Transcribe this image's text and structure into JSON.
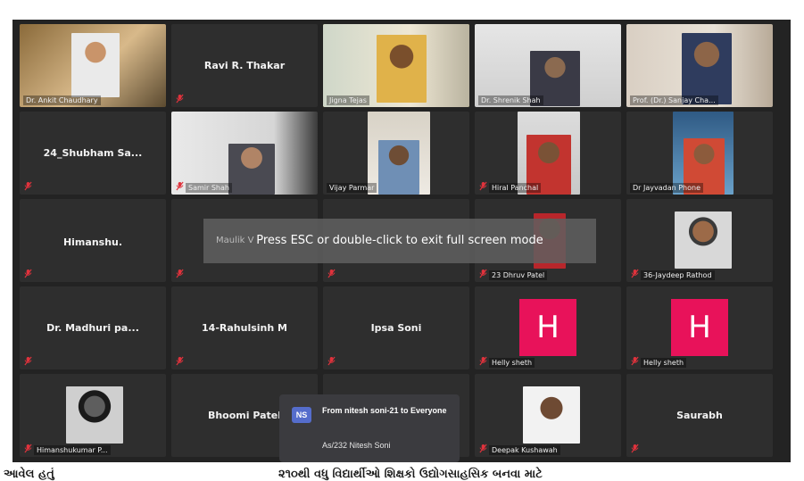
{
  "fullscreen_notice": "Press ESC or double-click to exit full screen mode",
  "faded_participant": "Maulik V",
  "participants": [
    {
      "name": "Dr. Ankit Chaudhary",
      "video": true
    },
    {
      "name": "Ravi R. Thakar",
      "video": false
    },
    {
      "name": "Jigna Tejas",
      "video": true,
      "active_speaker": true
    },
    {
      "name": "Dr. Shrenik Shah",
      "video": true
    },
    {
      "name": "Prof. (Dr.) Sanjay Cha...",
      "video": true
    },
    {
      "name": "24_Shubham Sa...",
      "video": false
    },
    {
      "name": "Samir Shah",
      "video": true
    },
    {
      "name": "Vijay Parmar",
      "video": true
    },
    {
      "name": "Hiral Panchal",
      "video": true
    },
    {
      "name": "Dr Jayvadan Phone",
      "video": true
    },
    {
      "name": "Himanshu.",
      "video": false
    },
    {
      "name": "23 Dhruv Patel",
      "video": true
    },
    {
      "name": "36-Jaydeep Rathod",
      "video": true
    },
    {
      "name": "Dr. Madhuri pa...",
      "video": false
    },
    {
      "name": "14-Rahulsinh M",
      "video": false
    },
    {
      "name": "Ipsa Soni",
      "video": false
    },
    {
      "name": "Helly sheth",
      "video": false,
      "avatar_letter": "H"
    },
    {
      "name": "Helly sheth",
      "video": false,
      "avatar_letter": "H"
    },
    {
      "name": "Himanshukumar P...",
      "video": true
    },
    {
      "name": "Bhoomi Patel",
      "video": false
    },
    {
      "name": "Deepak Kushawah",
      "video": true
    },
    {
      "name": "Saurabh",
      "video": false
    }
  ],
  "chat_notification": {
    "initials": "NS",
    "from": "From nitesh soni-21 to Everyone",
    "message": "As/232 Nitesh Soni"
  },
  "caption": {
    "left": "આવેલ હતું",
    "right": "૨૧૦થી વધુ વિદ્યાર્થીઓ શિક્ષકો ઉદ્યોગસાહસિક બનવા માટે"
  },
  "colors": {
    "background": "#232323",
    "tile": "#2e2e2e",
    "active_border": "#e6d43c",
    "avatar_pink": "#e8125a",
    "mute_red": "#e0323c",
    "chat_badge": "#556dcc"
  }
}
